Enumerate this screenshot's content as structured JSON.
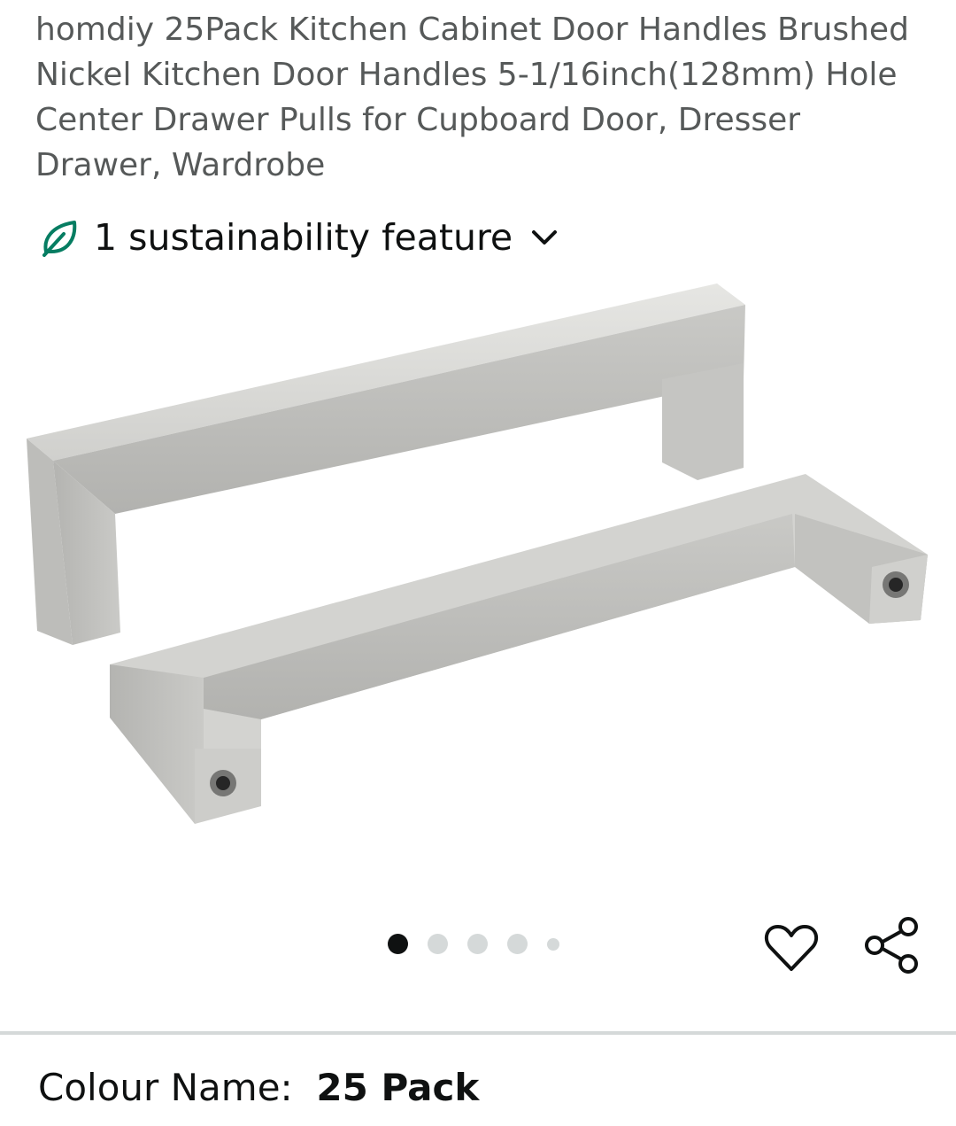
{
  "product": {
    "title": "homdiy 25Pack Kitchen Cabinet Door Handles Brushed Nickel Kitchen Door Handles 5-1/16inch(128mm) Hole Center Drawer Pulls for Cupboard Door, Dresser Drawer, Wardrobe"
  },
  "sustainability": {
    "label": "1 sustainability feature",
    "icon": "leaf-icon",
    "accent": "#067d62"
  },
  "gallery": {
    "image_alt": "Two brushed nickel square cabinet door handles",
    "dots": [
      {
        "state": "active"
      },
      {
        "state": "inactive"
      },
      {
        "state": "inactive"
      },
      {
        "state": "inactive"
      },
      {
        "state": "inactive-small"
      }
    ],
    "actions": [
      {
        "icon": "heart-icon"
      },
      {
        "icon": "share-icon"
      }
    ]
  },
  "variation": {
    "label": "Colour Name:",
    "value": "25 Pack"
  }
}
